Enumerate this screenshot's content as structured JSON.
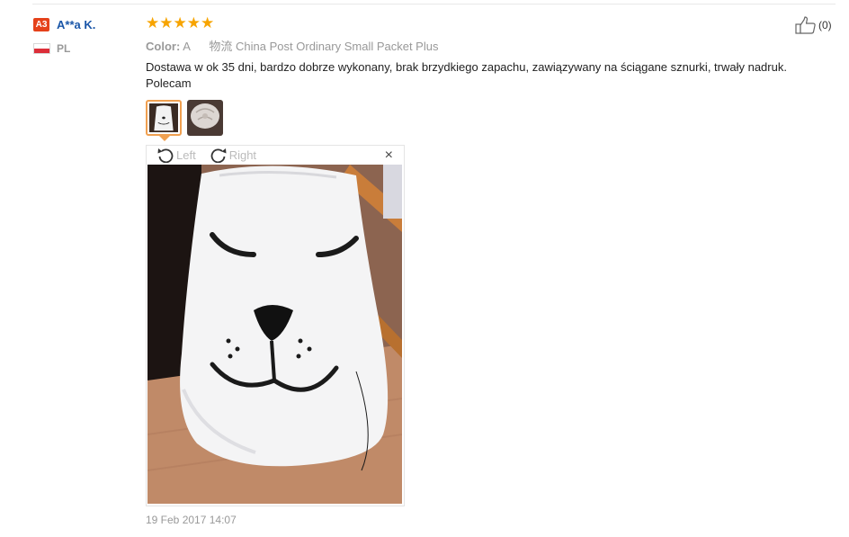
{
  "user": {
    "badge": "A3",
    "name": "A**a K.",
    "country": "PL"
  },
  "review": {
    "rating": 5,
    "stars": [
      "★",
      "★",
      "★",
      "★",
      "★"
    ],
    "color_label": "Color:",
    "color_value": "A",
    "logistics_label": "物流",
    "logistics_value": "China Post Ordinary Small Packet Plus",
    "text": "Dostawa w ok 35 dni, bardzo dobrze wykonany, brak brzydkiego zapachu, zawiązywany na ściągane sznurki, trwały nadruk. Polecam",
    "date": "19 Feb 2017 14:07"
  },
  "helpful": {
    "count": "(0)",
    "icon": "thumbs-up-icon"
  },
  "viewer": {
    "rotate_left_label": "Left",
    "rotate_right_label": "Right",
    "close_label": "×"
  },
  "colors": {
    "badge": "#e5411a",
    "username": "#1a56a8",
    "star": "#f7a400",
    "active_thumb_border": "#f0a050"
  }
}
